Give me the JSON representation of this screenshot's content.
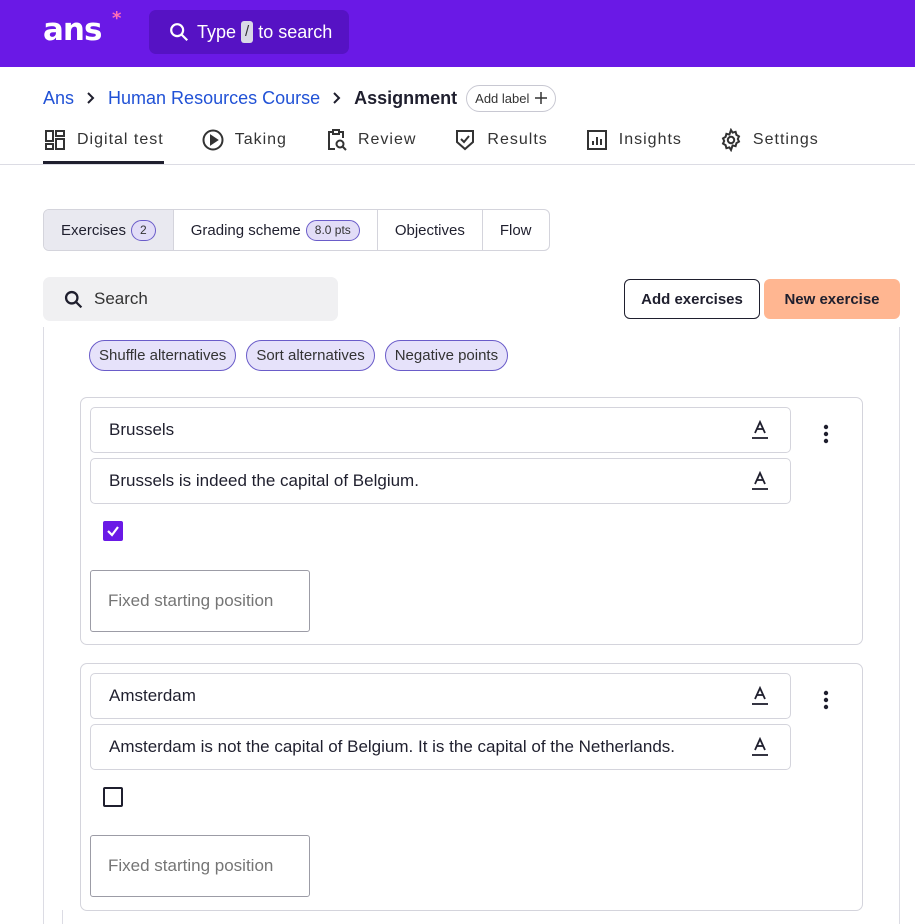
{
  "app": {
    "logo_text": "ans",
    "logo_star": "*",
    "search": {
      "prefix": "Type",
      "key": "/",
      "suffix": "to search"
    }
  },
  "breadcrumb": {
    "items": [
      "Ans",
      "Human Resources Course"
    ],
    "current": "Assignment",
    "add_label": "Add label"
  },
  "main_tabs": [
    {
      "label": "Digital test",
      "icon": "dashboard-icon",
      "active": true
    },
    {
      "label": "Taking",
      "icon": "play-icon"
    },
    {
      "label": "Review",
      "icon": "clipboard-search-icon"
    },
    {
      "label": "Results",
      "icon": "shield-check-icon"
    },
    {
      "label": "Insights",
      "icon": "bar-chart-icon"
    },
    {
      "label": "Settings",
      "icon": "gear-icon"
    }
  ],
  "sub_tabs": [
    {
      "label": "Exercises",
      "badge": "2",
      "active": true
    },
    {
      "label": "Grading scheme",
      "badge": "8.0 pts"
    },
    {
      "label": "Objectives"
    },
    {
      "label": "Flow"
    }
  ],
  "toolbar": {
    "search_placeholder": "Search",
    "add_exercises": "Add exercises",
    "new_exercise": "New exercise"
  },
  "options": [
    "Shuffle alternatives",
    "Sort alternatives",
    "Negative points"
  ],
  "alternatives": [
    {
      "answer": "Brussels",
      "feedback": "Brussels is indeed the capital of Belgium.",
      "correct": true,
      "fixed_position_placeholder": "Fixed starting position"
    },
    {
      "answer": "Amsterdam",
      "feedback": "Amsterdam is not the capital of Belgium. It is the capital of the Netherlands.",
      "correct": false,
      "fixed_position_placeholder": "Fixed starting position"
    }
  ],
  "colors": {
    "brand": "#6a19e6",
    "link": "#2152d6",
    "accent_button": "#ffb691",
    "pill_bg": "#e6e2fa"
  }
}
